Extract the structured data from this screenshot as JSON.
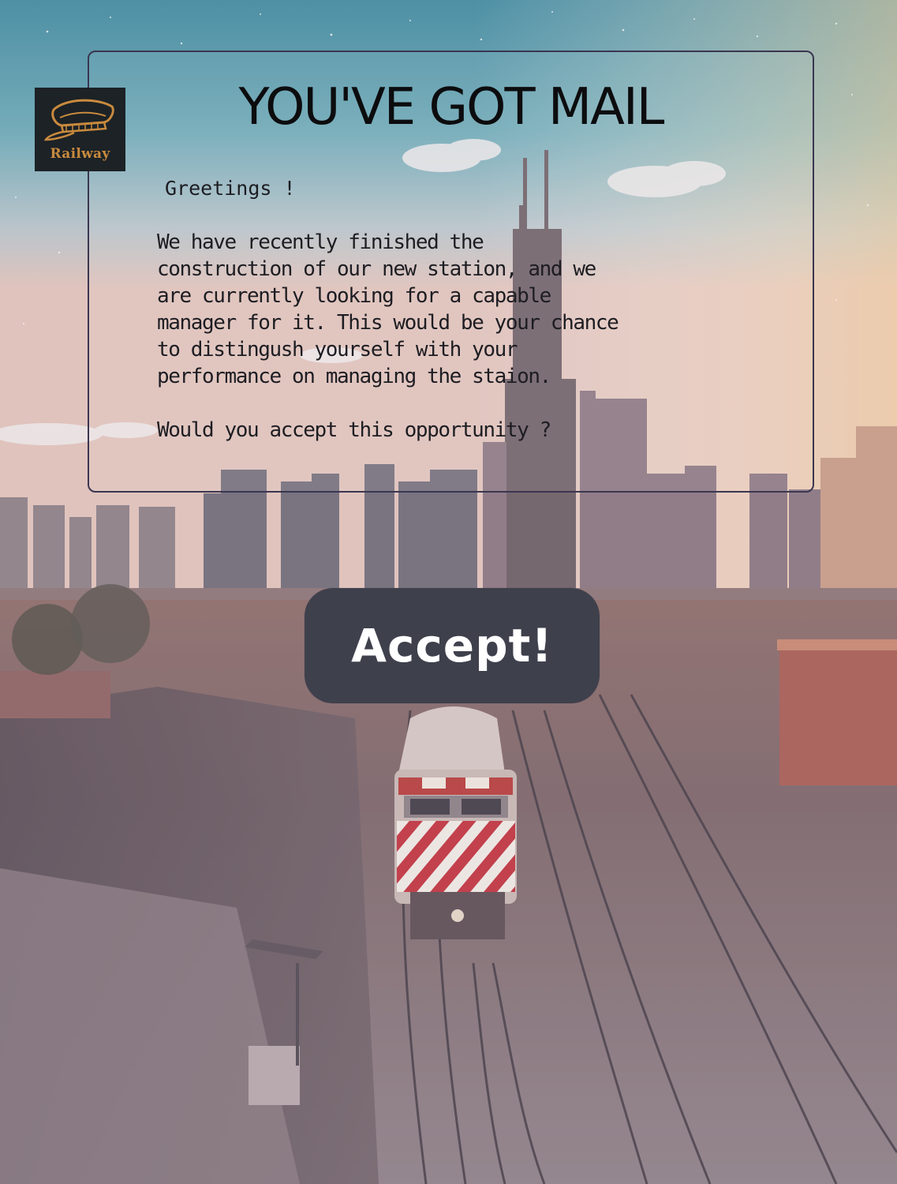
{
  "logo": {
    "icon": "conductor-cap-icon",
    "text": "Railway",
    "background": "#1c2226",
    "accent": "#c98a3e"
  },
  "mail": {
    "title": "YOU'VE GOT MAIL",
    "greeting": "Greetings !",
    "body_lines": [
      "We have recently finished the",
      "construction of our new station, and we",
      "are currently looking for a capable",
      "manager for it. This would be your chance",
      "to distingush yourself with your",
      "performance on managing the staion."
    ],
    "question": "Would you accept this opportunity ?"
  },
  "actions": {
    "accept_label": "Accept!",
    "accept_color": "#3e404c"
  },
  "background": {
    "description_icon": "city-railway-train-scene"
  }
}
